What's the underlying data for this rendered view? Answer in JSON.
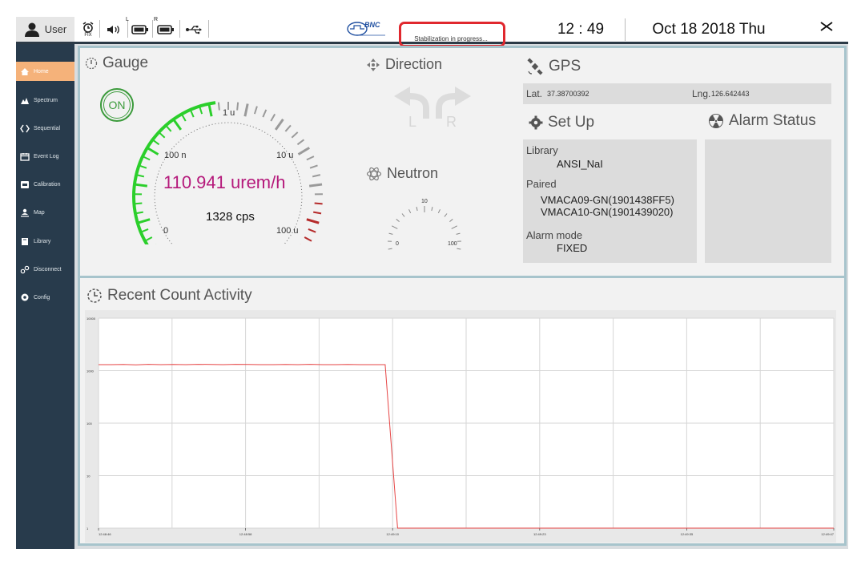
{
  "topbar": {
    "user_label": "User",
    "fix_label": "FIX",
    "battery_left_label": "L",
    "battery_right_label": "R",
    "logo_text": "BNC",
    "status_text": "Stabilization in progress...",
    "time": "12 : 49",
    "date": "Oct 18 2018 Thu",
    "close_glyph": "✕"
  },
  "sidebar": {
    "items": [
      {
        "label": "Home"
      },
      {
        "label": "Spectrum"
      },
      {
        "label": "Sequential"
      },
      {
        "label": "Event Log"
      },
      {
        "label": "Calibration"
      },
      {
        "label": "Map"
      },
      {
        "label": "Library"
      },
      {
        "label": "Disconnect"
      },
      {
        "label": "Config"
      }
    ]
  },
  "gauge": {
    "title": "Gauge",
    "on_label": "ON",
    "dose_rate": "110.941 urem/h",
    "count_rate": "1328 cps",
    "labels": {
      "zero": "0",
      "n100": "100 n",
      "u1": "1 u",
      "u10": "10 u",
      "u100": "100 u"
    }
  },
  "direction": {
    "title": "Direction",
    "left_label": "L",
    "right_label": "R"
  },
  "neutron": {
    "title": "Neutron",
    "labels": {
      "zero": "0",
      "ten": "10",
      "hundred": "100"
    }
  },
  "gps": {
    "title": "GPS",
    "lat_label": "Lat.",
    "lat_value": "37.38700392",
    "lng_label": "Lng.",
    "lng_value": "126.642443"
  },
  "setup": {
    "title": "Set Up",
    "library_label": "Library",
    "library_value": "ANSI_NaI",
    "paired_label": "Paired",
    "paired_1": "VMACA09-GN(1901438FF5)",
    "paired_2": "VMACA10-GN(1901439020)",
    "alarm_mode_label": "Alarm mode",
    "alarm_mode_value": "FIXED"
  },
  "alarm_status": {
    "title": "Alarm Status"
  },
  "chart_data": {
    "type": "line",
    "title": "Recent Count Activity",
    "y_scale": "log",
    "ylim": [
      1,
      10000
    ],
    "y_ticks": [
      "10000",
      "1000",
      "100",
      "10",
      "1"
    ],
    "x_ticks": [
      "12:48:46",
      "12:48:58",
      "12:49:10",
      "12:49:23",
      "12:49:35",
      "12:49:47"
    ],
    "grid": true,
    "series_color": "#e64545",
    "series": [
      {
        "values": [
          1300,
          1300,
          1310,
          1290,
          1320,
          1300,
          1310,
          1300,
          1320,
          1310,
          1300,
          1320,
          1310,
          1300,
          1300,
          1310,
          1300,
          1320,
          1300,
          1300,
          1310,
          1300,
          1300,
          1300,
          1,
          1,
          1,
          1,
          1,
          1,
          1,
          1,
          1,
          1,
          1,
          1,
          1,
          1,
          1,
          1,
          1,
          1,
          1,
          1,
          1,
          1,
          1,
          1,
          1,
          1,
          1,
          1,
          1,
          1,
          1,
          1,
          1,
          1,
          1,
          1
        ]
      }
    ]
  }
}
